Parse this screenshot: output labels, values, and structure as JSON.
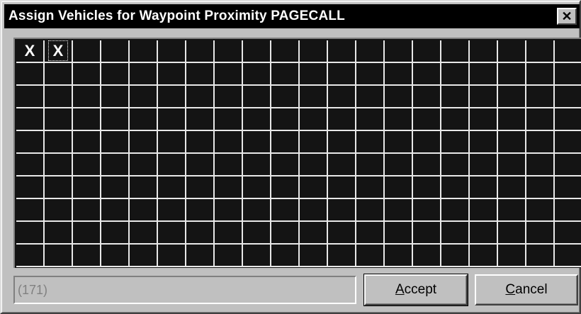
{
  "window": {
    "title": "Assign Vehicles for Waypoint Proximity PAGECALL",
    "close_label": "✕"
  },
  "grid": {
    "columns": 21,
    "rows": 10,
    "marked_cells": [
      {
        "row": 0,
        "col": 0,
        "mark": "X"
      },
      {
        "row": 0,
        "col": 1,
        "mark": "X",
        "focused": true
      }
    ]
  },
  "status": {
    "value": "(171)"
  },
  "buttons": {
    "accept_mnemonic": "A",
    "accept_rest": "ccept",
    "cancel_mnemonic": "C",
    "cancel_rest": "ancel"
  }
}
